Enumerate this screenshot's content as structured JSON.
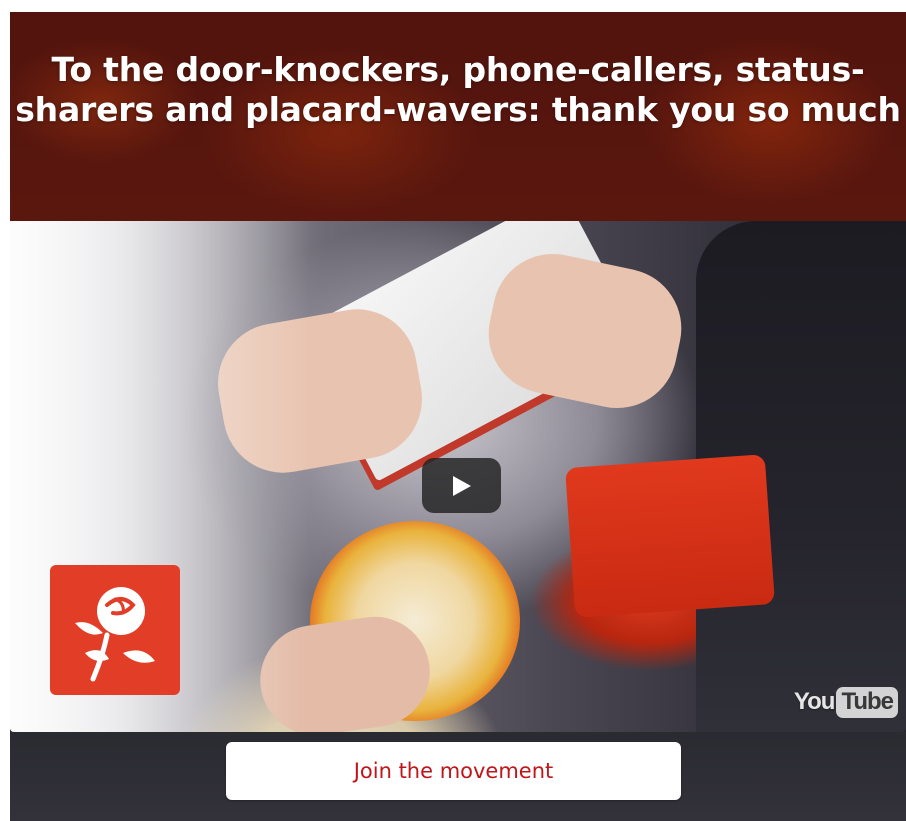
{
  "header": {
    "title": "To the door-knockers, phone-callers, status-sharers and placard-wavers: thank you so much"
  },
  "video": {
    "play_icon": "play-icon",
    "brand_logo_icon": "labour-rose-logo-icon",
    "watermark": {
      "part1": "You",
      "part2": "Tube"
    }
  },
  "cta": {
    "join_label": "Join the movement"
  },
  "colors": {
    "brand_red": "#e23d27",
    "cta_text": "#c0161a",
    "title_text": "#ffffff"
  }
}
